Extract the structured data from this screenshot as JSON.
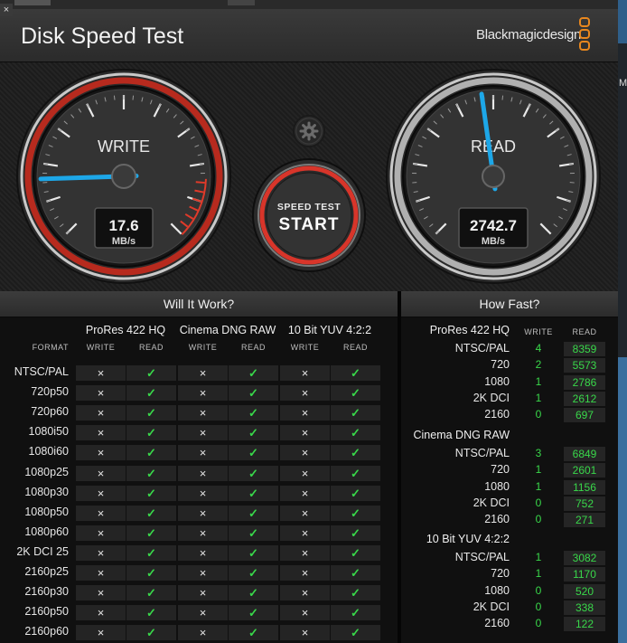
{
  "window": {
    "title": "Disk Speed Test",
    "brand": "Blackmagicdesign",
    "close_glyph": "×"
  },
  "colors": {
    "accent_blue": "#1da7e8",
    "gauge_red": "#e03a2a",
    "ok_green": "#39d84a",
    "header": "#333333"
  },
  "icons": {
    "close": "close-icon",
    "settings": "gear-icon",
    "logo": "blackmagic-logo-icon"
  },
  "write_gauge": {
    "label": "WRITE",
    "value": "17.6",
    "unit": "MB/s",
    "needle_fraction": 0.16
  },
  "read_gauge": {
    "label": "READ",
    "value": "2742.7",
    "unit": "MB/s",
    "needle_fraction": 0.47
  },
  "start_button": {
    "top_label": "SPEED TEST",
    "main_label": "START"
  },
  "will_it_work": {
    "title": "Will It Work?",
    "format_header": "FORMAT",
    "codecs": [
      {
        "name": "ProRes 422 HQ",
        "write": "WRITE",
        "read": "READ"
      },
      {
        "name": "Cinema DNG RAW",
        "write": "WRITE",
        "read": "READ"
      },
      {
        "name": "10 Bit YUV 4:2:2",
        "write": "WRITE",
        "read": "READ"
      }
    ],
    "marks": {
      "no": "×",
      "yes": "✓"
    },
    "rows": [
      {
        "format": "NTSC/PAL",
        "cells": [
          "no",
          "yes",
          "no",
          "yes",
          "no",
          "yes"
        ]
      },
      {
        "format": "720p50",
        "cells": [
          "no",
          "yes",
          "no",
          "yes",
          "no",
          "yes"
        ]
      },
      {
        "format": "720p60",
        "cells": [
          "no",
          "yes",
          "no",
          "yes",
          "no",
          "yes"
        ]
      },
      {
        "format": "1080i50",
        "cells": [
          "no",
          "yes",
          "no",
          "yes",
          "no",
          "yes"
        ]
      },
      {
        "format": "1080i60",
        "cells": [
          "no",
          "yes",
          "no",
          "yes",
          "no",
          "yes"
        ]
      },
      {
        "format": "1080p25",
        "cells": [
          "no",
          "yes",
          "no",
          "yes",
          "no",
          "yes"
        ]
      },
      {
        "format": "1080p30",
        "cells": [
          "no",
          "yes",
          "no",
          "yes",
          "no",
          "yes"
        ]
      },
      {
        "format": "1080p50",
        "cells": [
          "no",
          "yes",
          "no",
          "yes",
          "no",
          "yes"
        ]
      },
      {
        "format": "1080p60",
        "cells": [
          "no",
          "yes",
          "no",
          "yes",
          "no",
          "yes"
        ]
      },
      {
        "format": "2K DCI 25",
        "cells": [
          "no",
          "yes",
          "no",
          "yes",
          "no",
          "yes"
        ]
      },
      {
        "format": "2160p25",
        "cells": [
          "no",
          "yes",
          "no",
          "yes",
          "no",
          "yes"
        ]
      },
      {
        "format": "2160p30",
        "cells": [
          "no",
          "yes",
          "no",
          "yes",
          "no",
          "yes"
        ]
      },
      {
        "format": "2160p50",
        "cells": [
          "no",
          "yes",
          "no",
          "yes",
          "no",
          "yes"
        ]
      },
      {
        "format": "2160p60",
        "cells": [
          "no",
          "yes",
          "no",
          "yes",
          "no",
          "yes"
        ]
      }
    ]
  },
  "how_fast": {
    "title": "How Fast?",
    "groups": [
      {
        "name": "ProRes 422 HQ",
        "write": "WRITE",
        "read": "READ",
        "rows": [
          {
            "format": "NTSC/PAL",
            "write": "4",
            "read": "8359"
          },
          {
            "format": "720",
            "write": "2",
            "read": "5573"
          },
          {
            "format": "1080",
            "write": "1",
            "read": "2786"
          },
          {
            "format": "2K DCI",
            "write": "1",
            "read": "2612"
          },
          {
            "format": "2160",
            "write": "0",
            "read": "697"
          }
        ]
      },
      {
        "name": "Cinema DNG RAW",
        "write": "WRITE",
        "read": "READ",
        "rows": [
          {
            "format": "NTSC/PAL",
            "write": "3",
            "read": "6849"
          },
          {
            "format": "720",
            "write": "1",
            "read": "2601"
          },
          {
            "format": "1080",
            "write": "1",
            "read": "1156"
          },
          {
            "format": "2K DCI",
            "write": "0",
            "read": "752"
          },
          {
            "format": "2160",
            "write": "0",
            "read": "271"
          }
        ]
      },
      {
        "name": "10 Bit YUV 4:2:2",
        "write": "WRITE",
        "read": "READ",
        "rows": [
          {
            "format": "NTSC/PAL",
            "write": "1",
            "read": "3082"
          },
          {
            "format": "720",
            "write": "1",
            "read": "1170"
          },
          {
            "format": "1080",
            "write": "0",
            "read": "520"
          },
          {
            "format": "2K DCI",
            "write": "0",
            "read": "338"
          },
          {
            "format": "2160",
            "write": "0",
            "read": "122"
          }
        ]
      }
    ]
  },
  "background_window": {
    "partial_text": "M"
  }
}
